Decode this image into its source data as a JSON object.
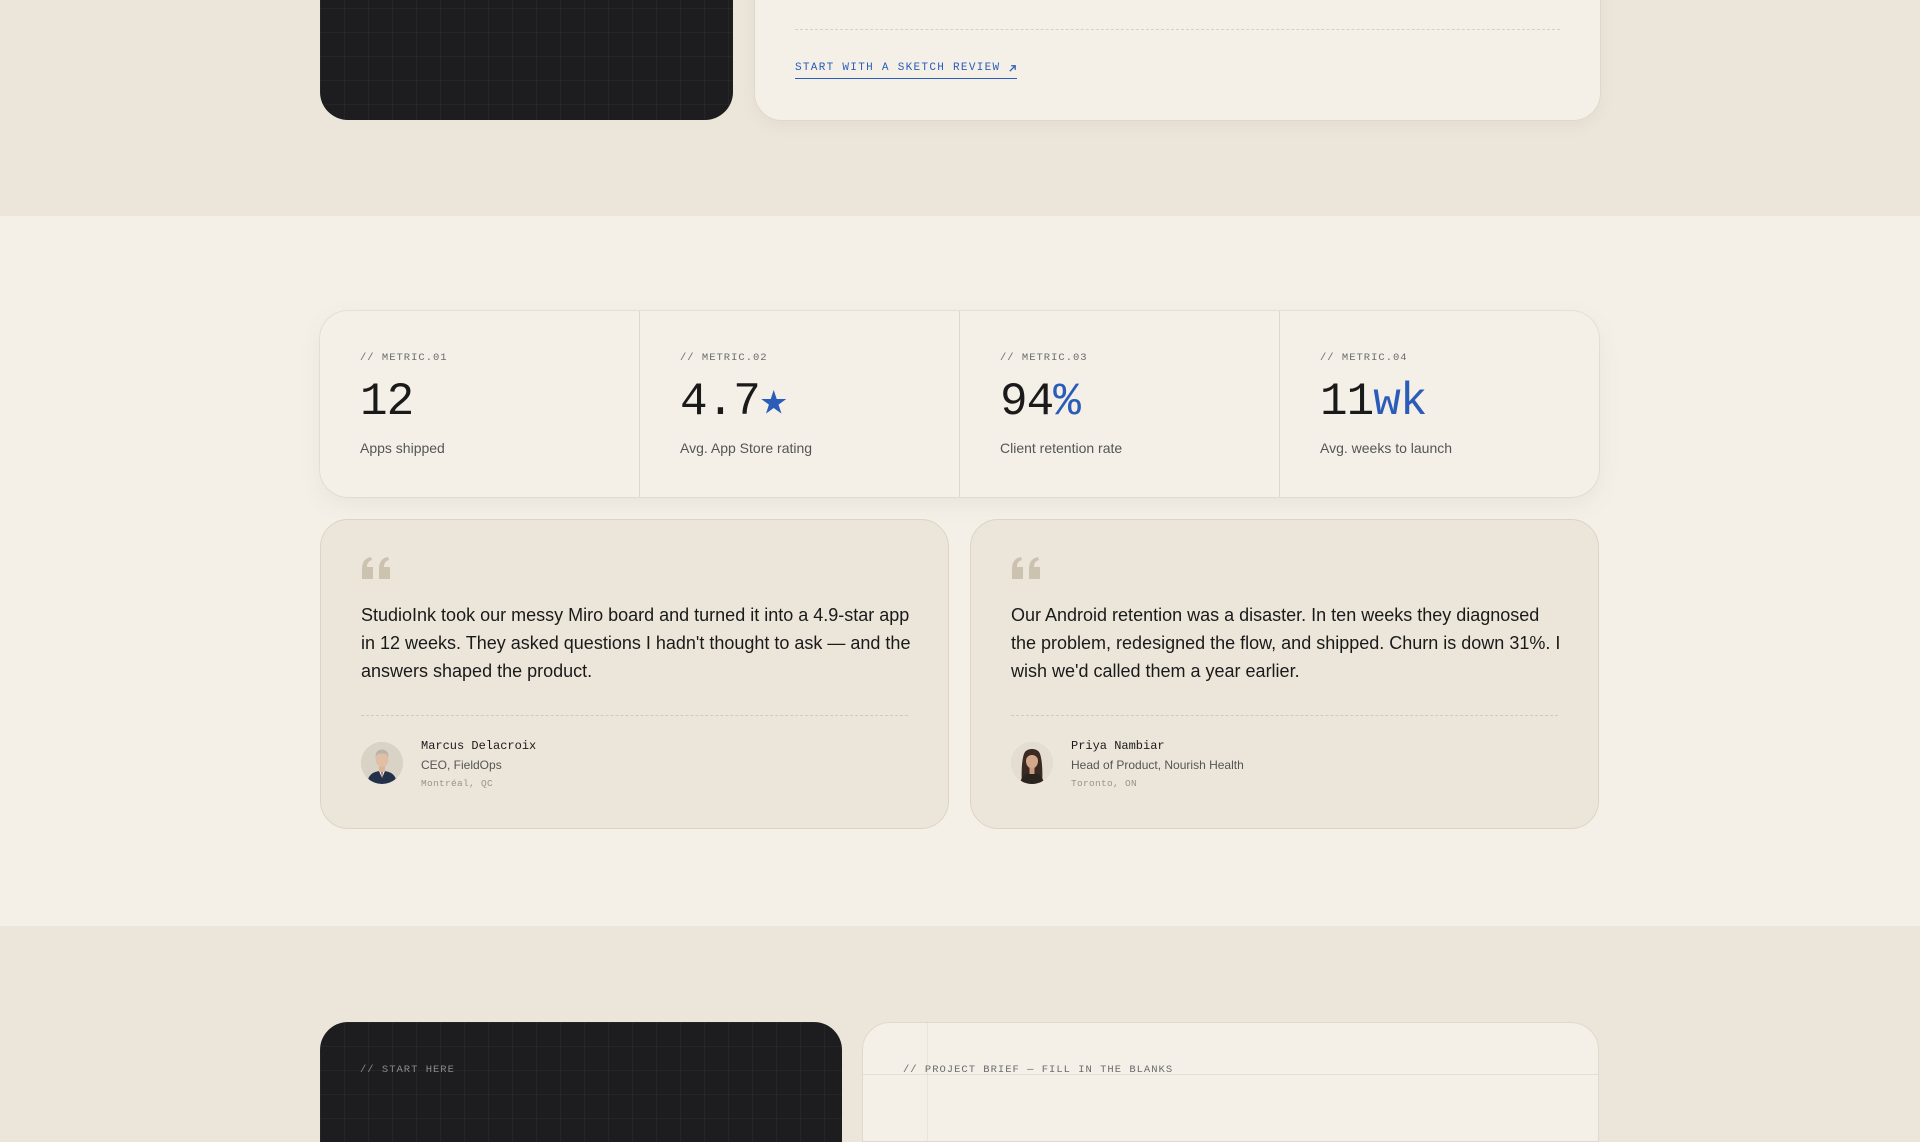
{
  "top_section": {
    "sketch_link": "START WITH A SKETCH REVIEW",
    "sketch_link_icon": "arrow-up-right-icon"
  },
  "metrics": [
    {
      "label": "// METRIC.01",
      "value": "12",
      "accent": "",
      "caption": "Apps shipped"
    },
    {
      "label": "// METRIC.02",
      "value": "4.7",
      "accent": "★",
      "caption": "Avg. App Store rating"
    },
    {
      "label": "// METRIC.03",
      "value": "94",
      "accent": "%",
      "caption": "Client retention rate"
    },
    {
      "label": "// METRIC.04",
      "value": "11",
      "accent": "wk",
      "caption": "Avg. weeks to launch"
    }
  ],
  "testimonials": [
    {
      "quote": "StudioInk took our messy Miro board and turned it into a 4.9-star app in 12 weeks. They asked questions I hadn't thought to ask — and the answers shaped the product.",
      "name": "Marcus Delacroix",
      "role": "CEO, FieldOps",
      "location": "Montréal, QC"
    },
    {
      "quote": "Our Android retention was a disaster. In ten weeks they diagnosed the problem, redesigned the flow, and shipped. Churn is down 31%. I wish we'd called them a year earlier.",
      "name": "Priya Nambiar",
      "role": "Head of Product, Nourish Health",
      "location": "Toronto, ON"
    }
  ],
  "bottom_section": {
    "start_label": "// START HERE",
    "brief_label": "// PROJECT BRIEF — FILL IN THE BLANKS"
  },
  "colors": {
    "accent": "#2b5cb8",
    "dark_card": "#1d1d1f",
    "cream": "#f4f0e8",
    "beige": "#ece6da"
  }
}
